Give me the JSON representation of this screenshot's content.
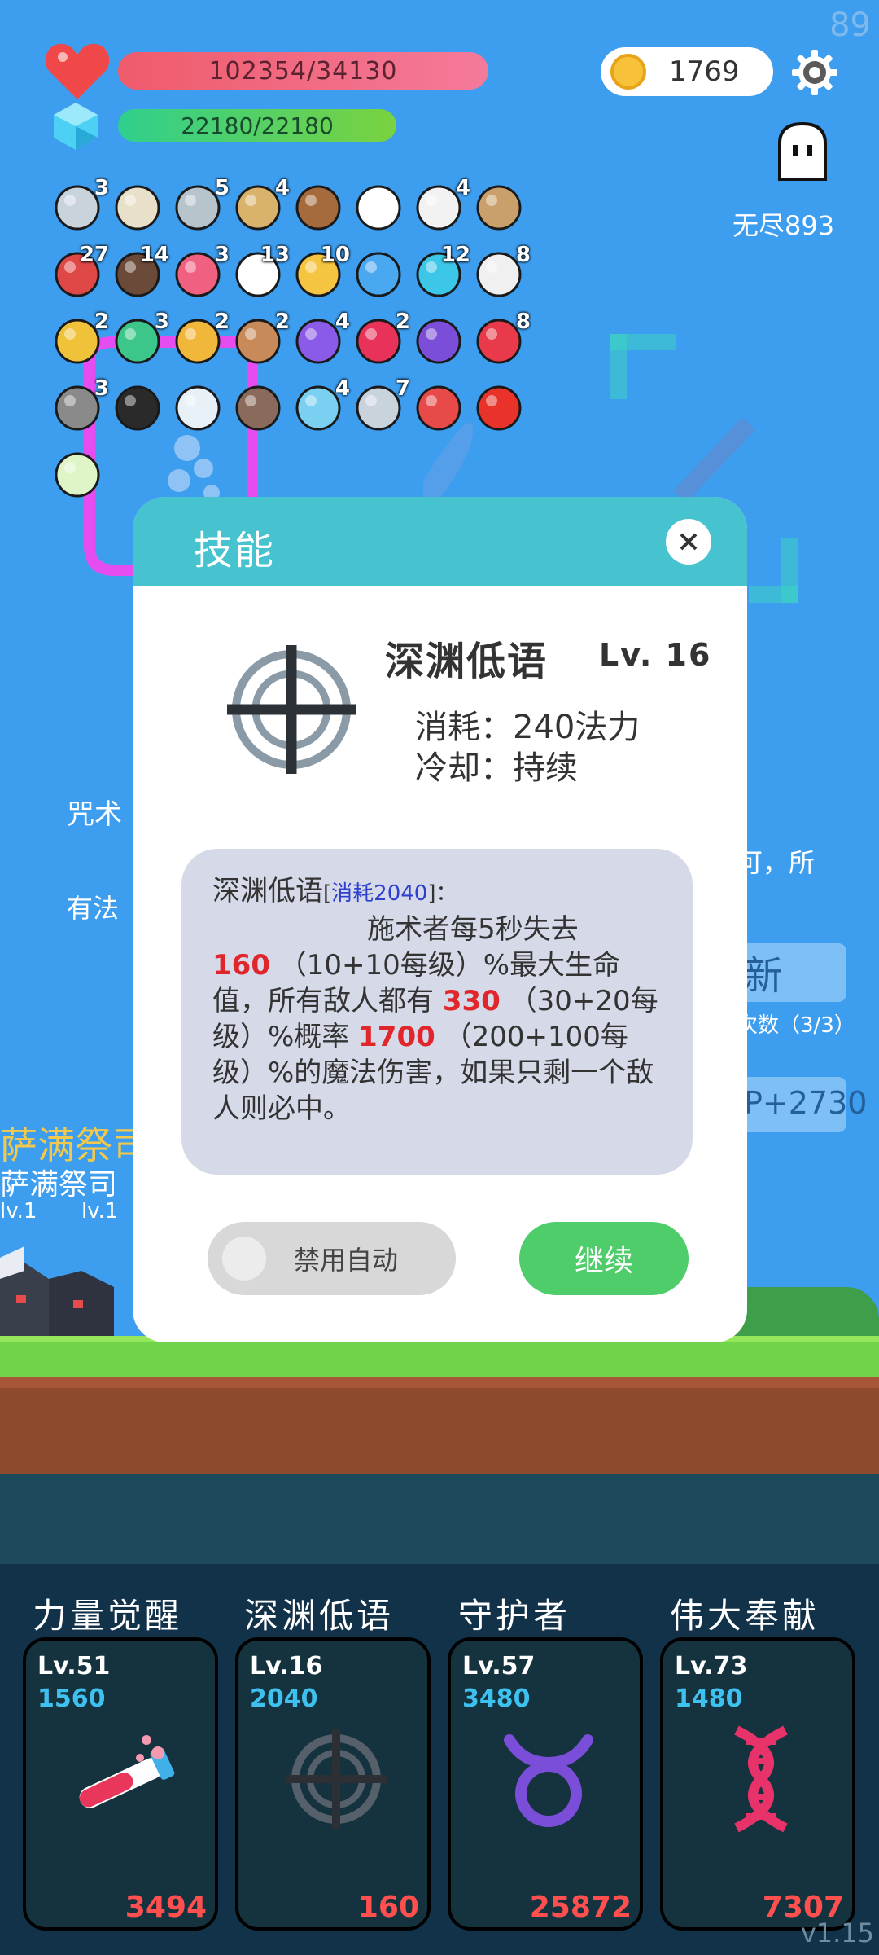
{
  "hud": {
    "fps": "89",
    "hp_text": "102354/34130",
    "mp_text": "22180/22180",
    "coins": "1769",
    "endless_label": "无尽893"
  },
  "items": [
    {
      "icon": "dagger-icon",
      "badge": "3"
    },
    {
      "icon": "sword-icon",
      "badge": ""
    },
    {
      "icon": "axe-icon",
      "badge": "5"
    },
    {
      "icon": "bow-icon",
      "badge": "4"
    },
    {
      "icon": "coconut-icon",
      "badge": ""
    },
    {
      "icon": "glove-icon",
      "badge": ""
    },
    {
      "icon": "dice-icon",
      "badge": "4"
    },
    {
      "icon": "viking-helmet-icon",
      "badge": ""
    },
    {
      "icon": "shield-icon",
      "badge": "27"
    },
    {
      "icon": "cannon-icon",
      "badge": "14"
    },
    {
      "icon": "pill-icon",
      "badge": "3"
    },
    {
      "icon": "ghost-icon",
      "badge": "13"
    },
    {
      "icon": "sunflower-icon",
      "badge": "10"
    },
    {
      "icon": "speech-bubble-icon",
      "badge": ""
    },
    {
      "icon": "gem-ring-icon",
      "badge": "12"
    },
    {
      "icon": "envelope-icon",
      "badge": "8"
    },
    {
      "icon": "ring-icon",
      "badge": "2"
    },
    {
      "icon": "potion-icon",
      "badge": "3"
    },
    {
      "icon": "wand-icon",
      "badge": "2"
    },
    {
      "icon": "cake-icon",
      "badge": "2"
    },
    {
      "icon": "crystal-ball-icon",
      "badge": "4"
    },
    {
      "icon": "hearts-icon",
      "badge": "2"
    },
    {
      "icon": "treasure-box-icon",
      "badge": ""
    },
    {
      "icon": "strawberry-icon",
      "badge": "8"
    },
    {
      "icon": "mace-icon",
      "badge": "3"
    },
    {
      "icon": "cauldron-icon",
      "badge": ""
    },
    {
      "icon": "lightbulb-icon",
      "badge": ""
    },
    {
      "icon": "tombstone-icon",
      "badge": ""
    },
    {
      "icon": "flask-icon",
      "badge": "4"
    },
    {
      "icon": "hook-icon",
      "badge": "7"
    },
    {
      "icon": "watermelon-icon",
      "badge": ""
    },
    {
      "icon": "apple-icon",
      "badge": ""
    },
    {
      "icon": "glowing-chip-icon",
      "badge": ""
    }
  ],
  "background": {
    "text1": "咒术",
    "text2": "有法",
    "text3": "可，所",
    "btn1": "新",
    "text4": "次数（3/3）",
    "btn2": "P+2730",
    "enemy_name": "萨满祭司",
    "enemy_sub": "萨满祭司",
    "lv_a": "lv.1",
    "lv_b": "lv.1"
  },
  "modal": {
    "title": "技能",
    "skill_name": "深渊低语",
    "skill_level": "Lv. 16",
    "consume": "消耗：240法力",
    "cooldown": "冷却：持续",
    "desc_name": "深渊低语",
    "desc_bracket_open": "[",
    "desc_cost": "消耗2040",
    "desc_bracket_close": "]：",
    "desc_line1": "施术者每5秒失去",
    "desc_val1": "160",
    "desc_rest1": "（10+10每级）%最大生命值，所有敌人都有",
    "desc_val2": "330",
    "desc_rest2": "（30+20每级）%概率",
    "desc_val3": "1700",
    "desc_rest3": "（200+100每级）%的魔法伤害，如果只剩一个敌人则必中。",
    "toggle_label": "禁用自动",
    "continue_label": "继续"
  },
  "skills": [
    {
      "title": "力量觉醒",
      "level": "Lv.51",
      "cost": "1560",
      "damage": "3494",
      "icon": "test-tube-icon"
    },
    {
      "title": "深渊低语",
      "level": "Lv.16",
      "cost": "2040",
      "damage": "160",
      "icon": "crosshair-icon"
    },
    {
      "title": "守护者",
      "level": "Lv.57",
      "cost": "3480",
      "damage": "25872",
      "icon": "taurus-icon"
    },
    {
      "title": "伟大奉献",
      "level": "Lv.73",
      "cost": "1480",
      "damage": "7307",
      "icon": "dna-icon"
    }
  ],
  "version": "v1.15",
  "colors": {
    "sky": "#3d9ef0",
    "modal_header": "#46c3cf",
    "continue_green": "#4ecd6a",
    "damage_red": "#ff4f4f",
    "cost_blue": "#3fc1f0"
  }
}
